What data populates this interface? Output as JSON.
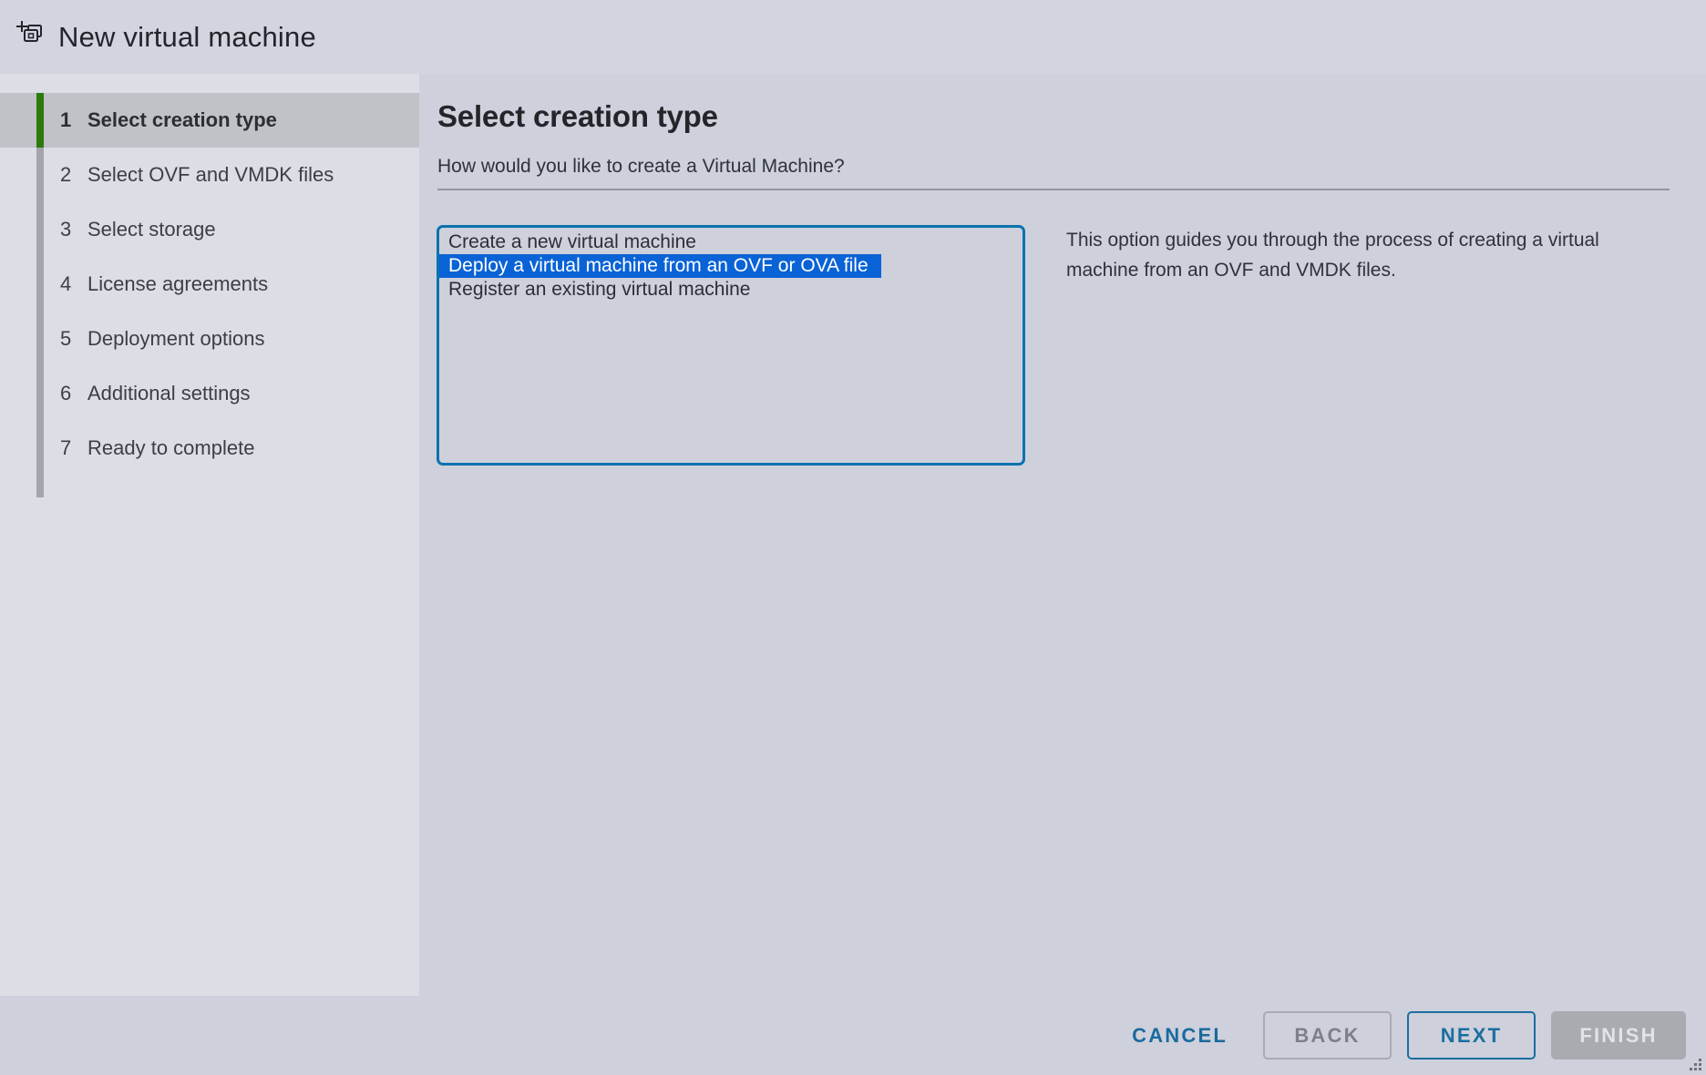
{
  "window": {
    "title": "New virtual machine",
    "icon": "new-vm-icon"
  },
  "sidebar": {
    "steps": [
      {
        "number": "1",
        "label": "Select creation type",
        "active": true
      },
      {
        "number": "2",
        "label": "Select OVF and VMDK files",
        "active": false
      },
      {
        "number": "3",
        "label": "Select storage",
        "active": false
      },
      {
        "number": "4",
        "label": "License agreements",
        "active": false
      },
      {
        "number": "5",
        "label": "Deployment options",
        "active": false
      },
      {
        "number": "6",
        "label": "Additional settings",
        "active": false
      },
      {
        "number": "7",
        "label": "Ready to complete",
        "active": false
      }
    ]
  },
  "main": {
    "page_title": "Select creation type",
    "page_subtitle": "How would you like to create a Virtual Machine?",
    "options": [
      {
        "label": "Create a new virtual machine",
        "selected": false
      },
      {
        "label": "Deploy a virtual machine from an OVF or OVA file",
        "selected": true
      },
      {
        "label": "Register an existing virtual machine",
        "selected": false
      }
    ],
    "description": "This option guides you through the process of creating a virtual machine from an OVF and VMDK files."
  },
  "footer": {
    "cancel_label": "CANCEL",
    "back_label": "BACK",
    "next_label": "NEXT",
    "finish_label": "FINISH"
  },
  "colors": {
    "window_background": "#ced0dc",
    "titlebar_background": "#d2d4df",
    "sidebar_background": "#dcdde5",
    "active_step_background": "#c0c2c8",
    "active_step_accent": "#2b7a0b",
    "step_track": "#a2a5ad",
    "listbox_border": "#0a73ad",
    "selection_blue": "#0a63d6",
    "selection_text": "#ffffff",
    "link_blue": "#1a6a9e",
    "disabled_gray": "#a9abb1"
  }
}
